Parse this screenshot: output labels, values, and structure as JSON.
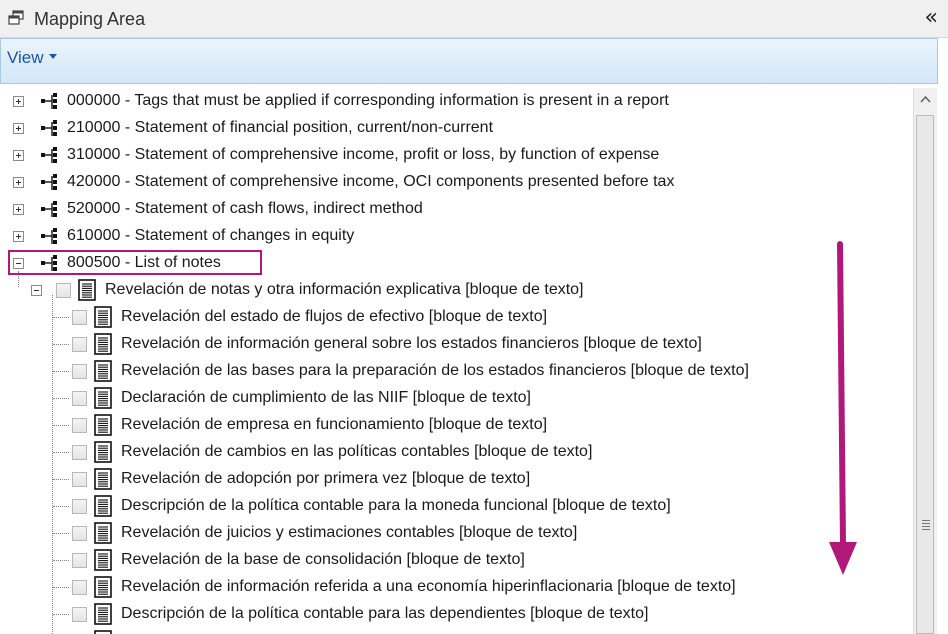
{
  "panel": {
    "title": "Mapping Area",
    "collapse_glyph": "«"
  },
  "toolbar": {
    "view_label": "View"
  },
  "tree": {
    "taxonomy_nodes": [
      {
        "label": "000000 - Tags that must be applied if corresponding information is present in a report",
        "state": "collapsed"
      },
      {
        "label": "210000 - Statement of financial position, current/non-current",
        "state": "collapsed"
      },
      {
        "label": "310000 - Statement of comprehensive income, profit or loss, by function of expense",
        "state": "collapsed"
      },
      {
        "label": "420000 - Statement of comprehensive income, OCI components presented before tax",
        "state": "collapsed"
      },
      {
        "label": "520000 - Statement of cash flows, indirect method",
        "state": "collapsed"
      },
      {
        "label": "610000 - Statement of changes in equity",
        "state": "collapsed"
      },
      {
        "label": "800500 - List of notes",
        "state": "expanded",
        "highlighted": true
      }
    ],
    "parent_item": {
      "label": "Revelación de notas y otra información explicativa [bloque de texto]",
      "state": "expanded"
    },
    "child_items": [
      {
        "label": "Revelación del estado de flujos de efectivo [bloque de texto]"
      },
      {
        "label": "Revelación de información general sobre los estados financieros [bloque de texto]"
      },
      {
        "label": "Revelación de las bases para la preparación de los estados financieros [bloque de texto]"
      },
      {
        "label": "Declaración de cumplimiento de las NIIF [bloque de texto]"
      },
      {
        "label": "Revelación de empresa en funcionamiento [bloque de texto]"
      },
      {
        "label": "Revelación de cambios en las políticas contables [bloque de texto]"
      },
      {
        "label": "Revelación de adopción por primera vez [bloque de texto]"
      },
      {
        "label": "Descripción de la política contable para la moneda funcional [bloque de texto]"
      },
      {
        "label": "Revelación de juicios y estimaciones contables [bloque de texto]"
      },
      {
        "label": "Revelación de la base de consolidación [bloque de texto]"
      },
      {
        "label": "Revelación de información referida a una economía hiperinflacionaria [bloque de texto]"
      },
      {
        "label": "Descripción de la política contable para las dependientes [bloque de texto]"
      },
      {
        "label": ""
      }
    ]
  },
  "colors": {
    "highlight_border": "#b0187a",
    "annotation_arrow": "#b0187a",
    "view_menu_text": "#1a56a8"
  }
}
